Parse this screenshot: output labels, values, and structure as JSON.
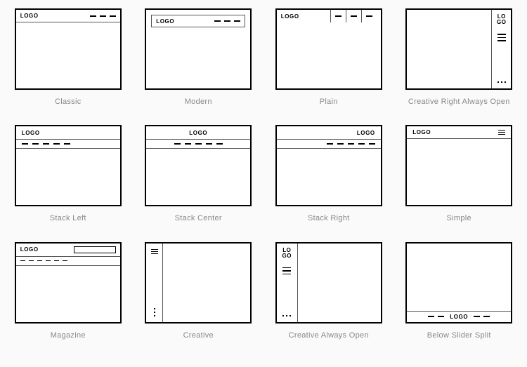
{
  "logo_text": "LOGO",
  "logo_stacked_line1": "LO",
  "logo_stacked_line2": "GO",
  "layouts": [
    {
      "id": "classic",
      "label": "Classic"
    },
    {
      "id": "modern",
      "label": "Modern"
    },
    {
      "id": "plain",
      "label": "Plain"
    },
    {
      "id": "creative-right-always-open",
      "label": "Creative Right Always Open"
    },
    {
      "id": "stack-left",
      "label": "Stack Left"
    },
    {
      "id": "stack-center",
      "label": "Stack Center"
    },
    {
      "id": "stack-right",
      "label": "Stack Right"
    },
    {
      "id": "simple",
      "label": "Simple"
    },
    {
      "id": "magazine",
      "label": "Magazine"
    },
    {
      "id": "creative",
      "label": "Creative"
    },
    {
      "id": "creative-always-open",
      "label": "Creative Always Open"
    },
    {
      "id": "below-slider-split",
      "label": "Below Slider Split"
    }
  ]
}
